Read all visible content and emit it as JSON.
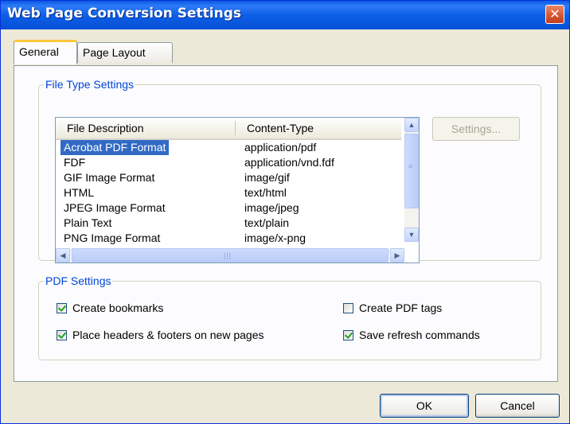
{
  "window": {
    "title": "Web Page Conversion Settings",
    "close_label": "✕"
  },
  "tabs": [
    {
      "label": "General",
      "active": true
    },
    {
      "label": "Page Layout",
      "active": false
    }
  ],
  "file_type_settings": {
    "legend": "File Type Settings",
    "columns": [
      "File Description",
      "Content-Type"
    ],
    "rows": [
      {
        "description": "Acrobat PDF Format",
        "content_type": "application/pdf",
        "selected": true
      },
      {
        "description": "FDF",
        "content_type": "application/vnd.fdf"
      },
      {
        "description": "GIF Image Format",
        "content_type": "image/gif"
      },
      {
        "description": "HTML",
        "content_type": "text/html"
      },
      {
        "description": "JPEG Image Format",
        "content_type": "image/jpeg"
      },
      {
        "description": "Plain Text",
        "content_type": "text/plain"
      },
      {
        "description": "PNG Image Format",
        "content_type": "image/x-png"
      }
    ],
    "settings_button": "Settings..."
  },
  "pdf_settings": {
    "legend": "PDF Settings",
    "create_bookmarks": {
      "label": "Create bookmarks",
      "checked": true
    },
    "place_headers_footers": {
      "label": "Place headers & footers on new pages",
      "checked": true
    },
    "create_pdf_tags": {
      "label": "Create PDF tags",
      "checked": false
    },
    "save_refresh_commands": {
      "label": "Save refresh commands",
      "checked": true
    }
  },
  "buttons": {
    "ok": "OK",
    "cancel": "Cancel"
  },
  "colors": {
    "title_bar": "#0a58e4",
    "dialog_bg": "#ece9d8",
    "selection": "#316ac5",
    "legend_text": "#0046d5"
  }
}
